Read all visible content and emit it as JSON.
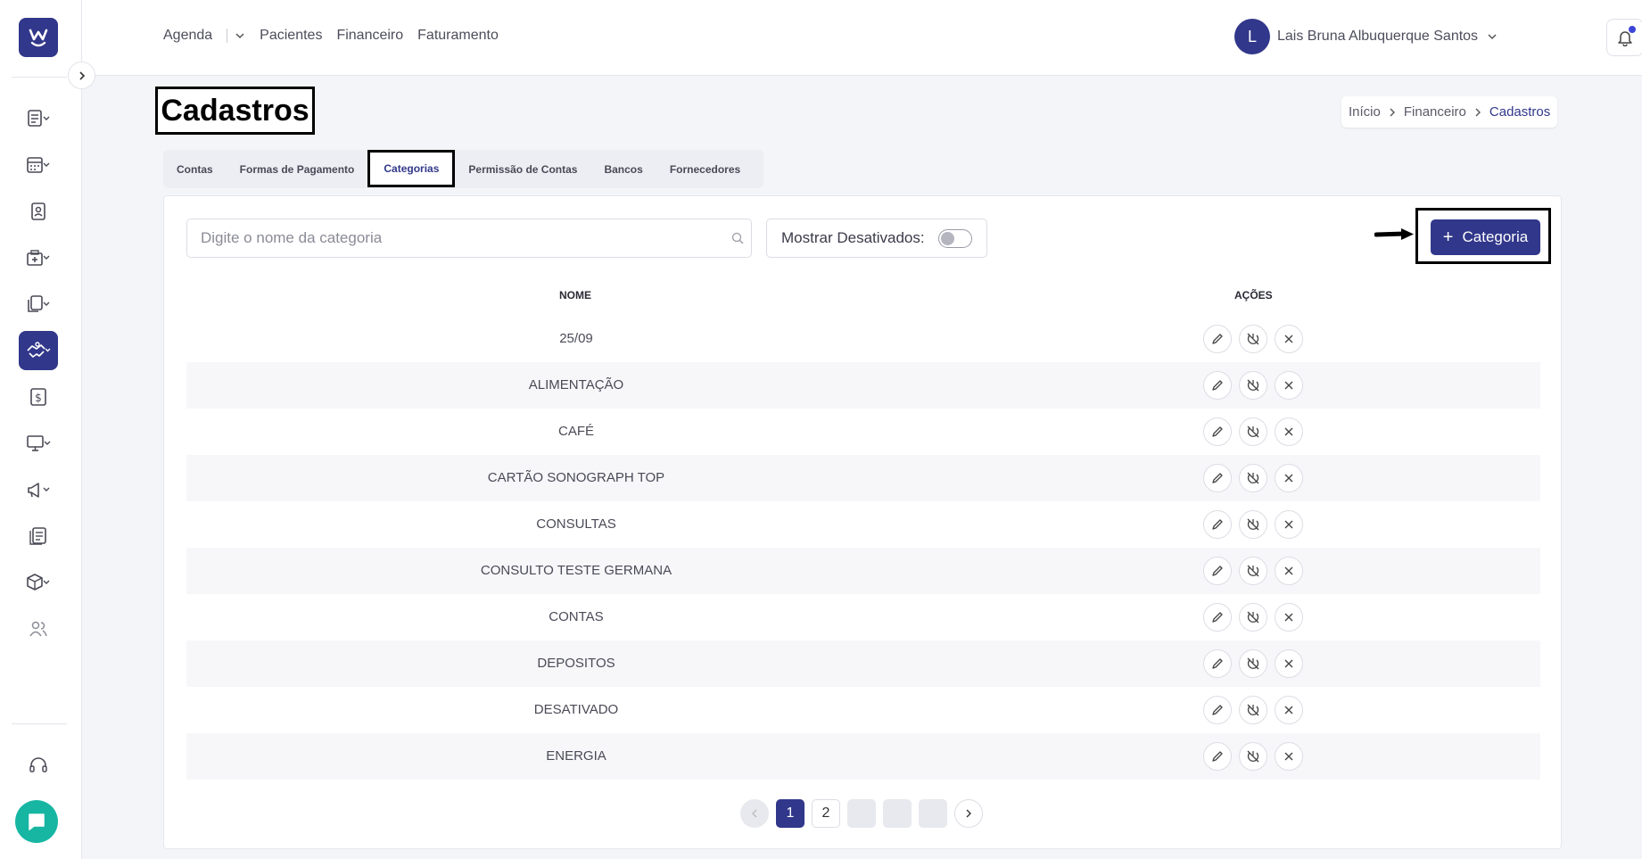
{
  "sidebar": {
    "logo_letter": "W",
    "items": [
      {
        "name": "agenda-icon"
      },
      {
        "name": "calendar-icon"
      },
      {
        "name": "patient-card-icon"
      },
      {
        "name": "clinic-icon"
      },
      {
        "name": "documents-icon"
      },
      {
        "name": "finance-handshake-icon",
        "active": true
      },
      {
        "name": "dollar-icon"
      },
      {
        "name": "monitor-icon"
      },
      {
        "name": "megaphone-icon"
      },
      {
        "name": "reports-icon"
      },
      {
        "name": "box-icon"
      },
      {
        "name": "users-icon"
      },
      {
        "name": "headset-icon"
      }
    ]
  },
  "topnav": {
    "agenda": "Agenda",
    "pacientes": "Pacientes",
    "financeiro": "Financeiro",
    "faturamento": "Faturamento"
  },
  "user": {
    "initial": "L",
    "name": "Lais Bruna Albuquerque Santos"
  },
  "header": {
    "title": "Cadastros",
    "breadcrumb": [
      "Início",
      "Financeiro",
      "Cadastros"
    ]
  },
  "tabs": [
    {
      "label": "Contas"
    },
    {
      "label": "Formas de Pagamento"
    },
    {
      "label": "Categorias",
      "active": true
    },
    {
      "label": "Permissão de Contas"
    },
    {
      "label": "Bancos"
    },
    {
      "label": "Fornecedores"
    }
  ],
  "toolbar": {
    "search_placeholder": "Digite o nome da categoria",
    "toggle_label": "Mostrar Desativados:",
    "toggle_on": false,
    "add_label": "Categoria",
    "add_plus": "+"
  },
  "table": {
    "col_name": "NOME",
    "col_actions": "AÇÕES",
    "rows": [
      "25/09",
      "ALIMENTAÇÃO",
      "CAFÉ",
      "CARTÃO SONOGRAPH TOP",
      "CONSULTAS",
      "CONSULTO TESTE GERMANA",
      "CONTAS",
      "DEPOSITOS",
      "DESATIVADO",
      "ENERGIA"
    ]
  },
  "pagination": {
    "pages": [
      "1",
      "2"
    ],
    "current": "1"
  },
  "colors": {
    "primary": "#31378a",
    "chat": "#17b6a3"
  }
}
